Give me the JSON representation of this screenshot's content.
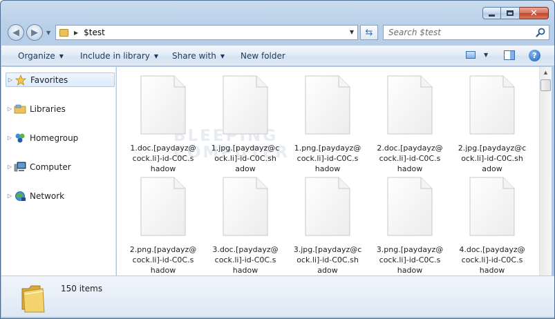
{
  "window": {
    "controls": {
      "minimize_icon": "minimize-icon",
      "maximize_icon": "maximize-icon",
      "close_icon": "close-icon"
    }
  },
  "address": {
    "path": "$test"
  },
  "search": {
    "placeholder": "Search $test"
  },
  "toolbar": {
    "organize": "Organize",
    "include_in_library": "Include in library",
    "share_with": "Share with",
    "new_folder": "New folder"
  },
  "nav": {
    "items": [
      {
        "label": "Favorites",
        "icon": "star-icon"
      },
      {
        "label": "Libraries",
        "icon": "libraries-icon"
      },
      {
        "label": "Homegroup",
        "icon": "homegroup-icon"
      },
      {
        "label": "Computer",
        "icon": "computer-icon"
      },
      {
        "label": "Network",
        "icon": "network-icon"
      }
    ]
  },
  "files": [
    {
      "line1": "1.doc.[paydayz@",
      "line2": "cock.li]-id-C0C.s",
      "line3": "hadow"
    },
    {
      "line1": "1.jpg.[paydayz@c",
      "line2": "ock.li]-id-C0C.sh",
      "line3": "adow"
    },
    {
      "line1": "1.png.[paydayz@",
      "line2": "cock.li]-id-C0C.s",
      "line3": "hadow"
    },
    {
      "line1": "2.doc.[paydayz@",
      "line2": "cock.li]-id-C0C.s",
      "line3": "hadow"
    },
    {
      "line1": "2.jpg.[paydayz@c",
      "line2": "ock.li]-id-C0C.sh",
      "line3": "adow"
    },
    {
      "line1": "2.png.[paydayz@",
      "line2": "cock.li]-id-C0C.s",
      "line3": "hadow"
    },
    {
      "line1": "3.doc.[paydayz@",
      "line2": "cock.li]-id-C0C.s",
      "line3": "hadow"
    },
    {
      "line1": "3.jpg.[paydayz@c",
      "line2": "ock.li]-id-C0C.sh",
      "line3": "adow"
    },
    {
      "line1": "3.png.[paydayz@",
      "line2": "cock.li]-id-C0C.s",
      "line3": "hadow"
    },
    {
      "line1": "4.doc.[paydayz@",
      "line2": "cock.li]-id-C0C.s",
      "line3": "hadow"
    }
  ],
  "watermark": {
    "line1": "BLEEPING",
    "line2": "COMPUTER"
  },
  "details": {
    "count": "150 items"
  },
  "colors": {
    "frame": "#b8cfe8",
    "selection": "#dcebfc",
    "accent": "#1e395b"
  }
}
